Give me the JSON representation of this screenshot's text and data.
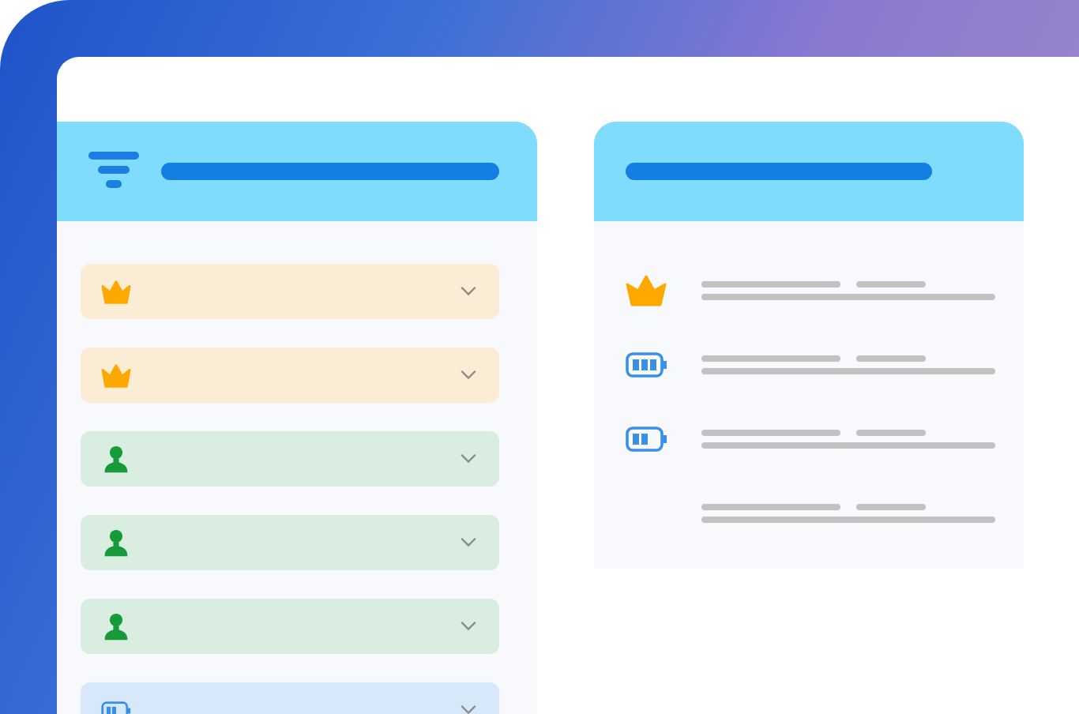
{
  "filter_panel": {
    "items": [
      {
        "kind": "crown",
        "expanded": false
      },
      {
        "kind": "crown",
        "expanded": false
      },
      {
        "kind": "person",
        "expanded": false
      },
      {
        "kind": "person",
        "expanded": false
      },
      {
        "kind": "person",
        "expanded": false
      },
      {
        "kind": "battery",
        "expanded": false
      }
    ]
  },
  "detail_panel": {
    "items": [
      {
        "kind": "crown"
      },
      {
        "kind": "battery_full"
      },
      {
        "kind": "battery_half"
      },
      {
        "kind": "none"
      }
    ]
  }
}
